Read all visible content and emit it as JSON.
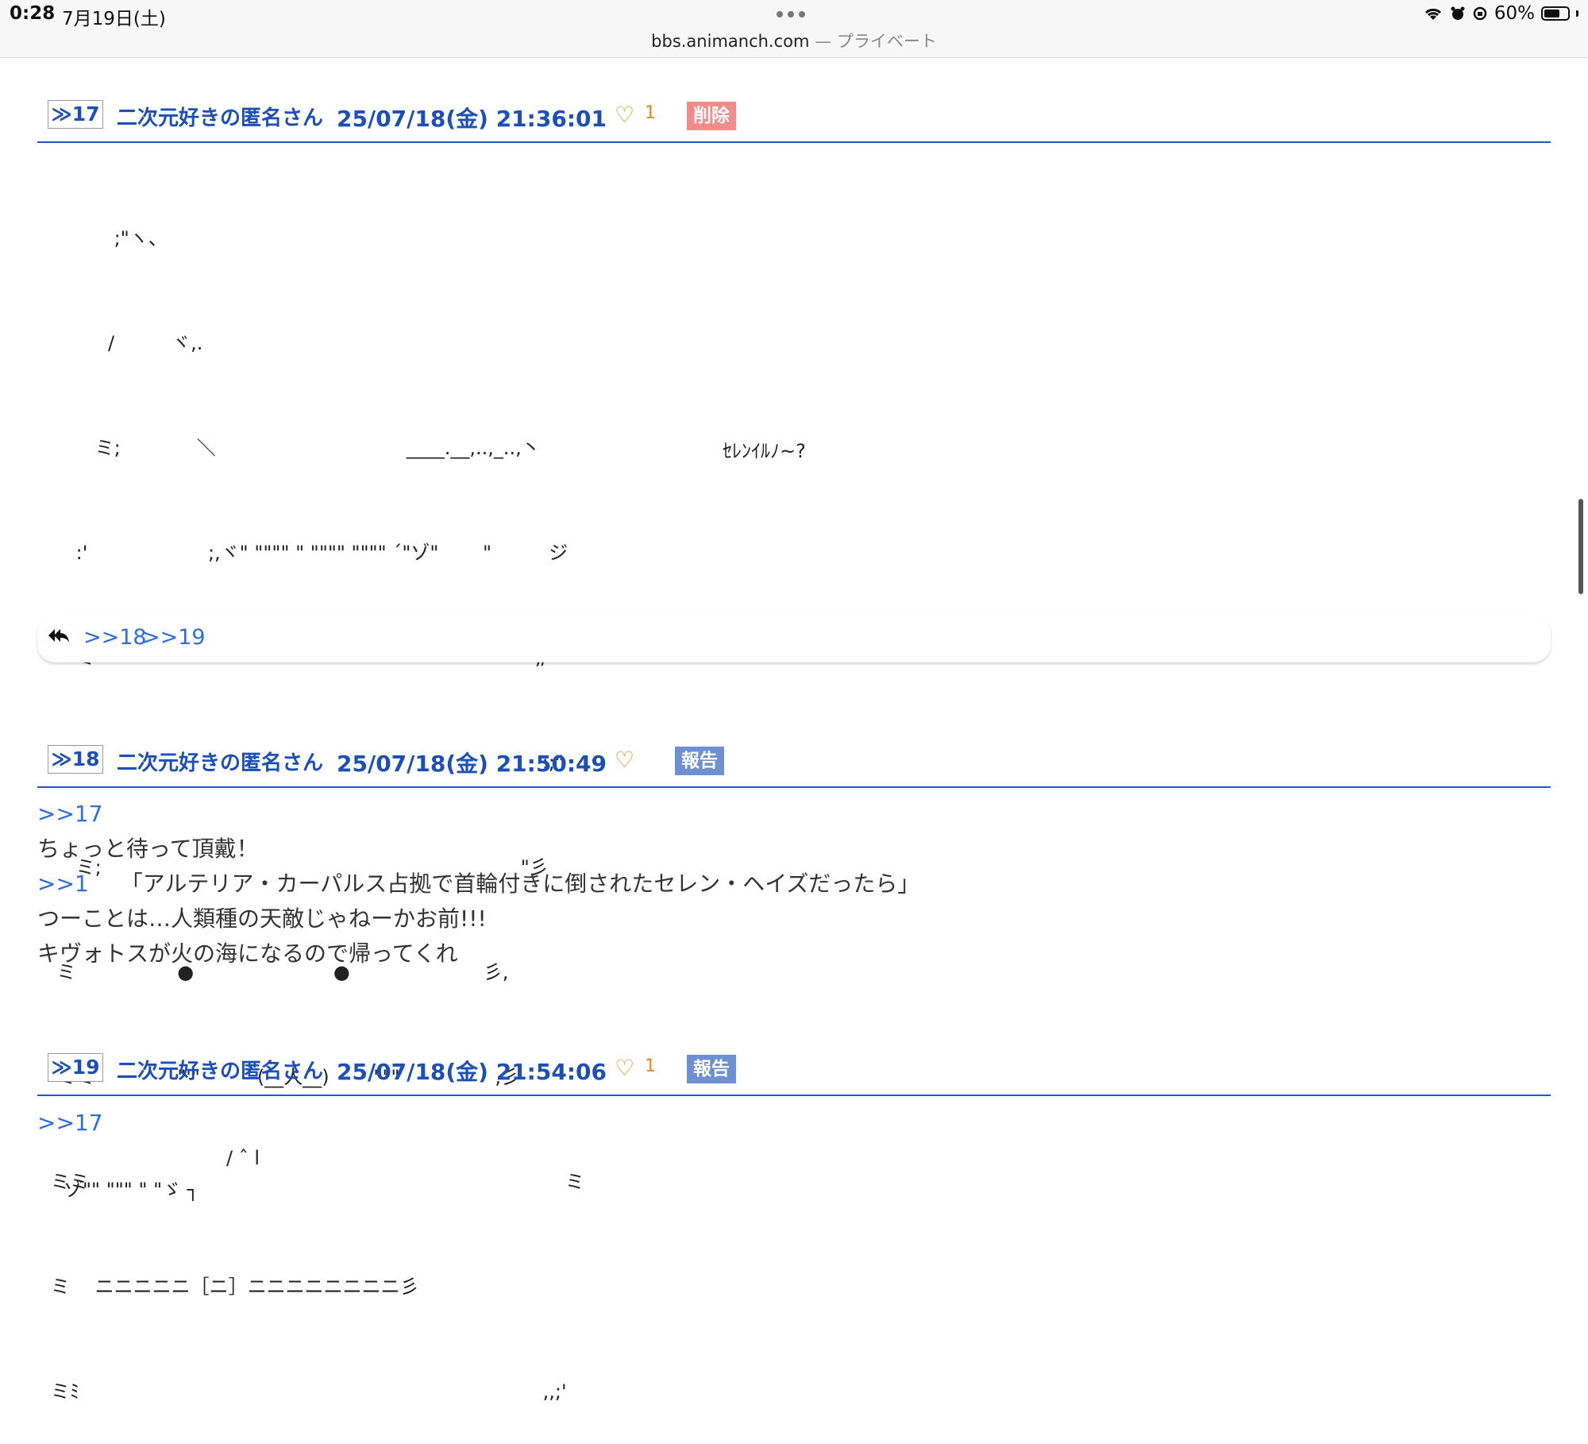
{
  "status_bar": {
    "time": "0:28",
    "date": "7月19日(土)",
    "url_host": "bbs.animanch.com",
    "url_suffix": " — プライベート",
    "battery": "60%"
  },
  "posts": [
    {
      "number": "≫17",
      "author": "二次元好きの匿名さん",
      "timestamp": "25/07/18(金) 21:36:01",
      "likes": "1",
      "action_label": "削除",
      "aa_lines": [
        "　　　 ;\"ヽ、",
        "　　　/　　　ヾ,.",
        "　　 ミ;　　　　＼　　　　　　　　　　____.__,..,_..,丶",
        "　 :'　　　　　　 ;,ヾ\" \"\"\"\" \" \"\"\"\" \"\"\"\" ´\"ゾ\"　　 \"　　　ジ",
        "　 ミ　　　　　 \"　　　　　　　　　　　　　　　　　 ,/\"",
        "　 ミ\"　　　　　　　　　　　　　　　　　　　　　　　;;\"",
        "　 ミ;　　　　　　　　　　　　　　　　　　　　　　\"彡",
        " ミ　　　　　 ●　　　　　　　 ●　　　　　　　彡,",
        " ミミ　　　　 \"'\"　　　(__人__)　　 \"\"\"　　　　　,彡",
        "ミミ　　　　　　　　　　　　　　　　　　　　　　　　　ミ",
        "ミ　 ニニニニニ［ニ］ニニニニニニニニ彡",
        "ミﾐ　　　　　　　　　　　　　　　　　　　　　　　　 ,,;'"
      ],
      "aa_note": "ｾﾚﾝｲﾙﾉ~?",
      "replies": [
        ">>18",
        ">>19"
      ]
    },
    {
      "number": "≫18",
      "author": "二次元好きの匿名さん",
      "timestamp": "25/07/18(金) 21:50:49",
      "likes": "",
      "action_label": "報告",
      "anchor": ">>17",
      "line1": "ちょっと待って頂戴！",
      "quote_anchor": ">>1",
      "quote_text": "「アルテリア・カーパルス占拠で首輪付きに倒されたセレン・ヘイズだったら」",
      "line3": "つーことは…人類種の天敵じゃねーかお前!!!",
      "line4": "キヴォトスが火の海になるので帰ってくれ"
    },
    {
      "number": "≫19",
      "author": "二次元好きの匿名さん",
      "timestamp": "25/07/18(金) 21:54:06",
      "likes": "1",
      "action_label": "報告",
      "anchor": ">>17",
      "aa_line1": "/ ˆ l",
      "aa_line2": "ゾ\"\" \"\"\" \" \"ゞ ┐"
    }
  ]
}
